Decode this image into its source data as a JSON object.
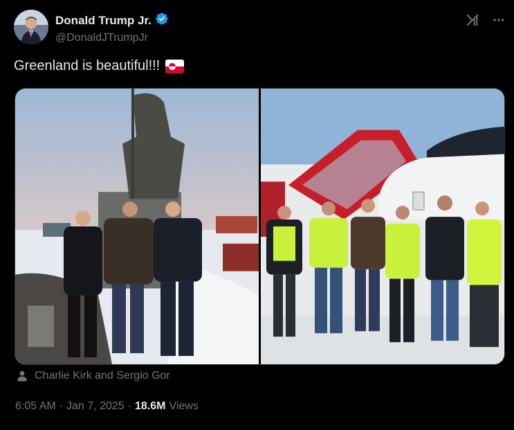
{
  "author": {
    "display_name": "Donald Trump Jr.",
    "handle": "@DonaldJTrumpJr",
    "verified": true,
    "verified_color": "#1d9bf0"
  },
  "tweet": {
    "text": "Greenland is beautiful!!!",
    "emoji": "greenland-flag"
  },
  "media": {
    "count": 2,
    "photos": [
      {
        "subject": "statue-group-photo"
      },
      {
        "subject": "jet-crew-group-photo"
      }
    ]
  },
  "tagged": {
    "text": "Charlie Kirk and Sergio Gor",
    "icon": "person-icon"
  },
  "meta": {
    "time": "6:05 AM",
    "separator1": "·",
    "date": "Jan 7, 2025",
    "separator2": "·",
    "views_count": "18.6M",
    "views_label": "Views"
  },
  "icons": {
    "grok": "grok-icon",
    "more": "more-icon"
  },
  "colors": {
    "background": "#000000",
    "primary_text": "#e7e9ea",
    "secondary_text": "#71767b",
    "accent": "#1d9bf0",
    "border": "#2f3336"
  }
}
